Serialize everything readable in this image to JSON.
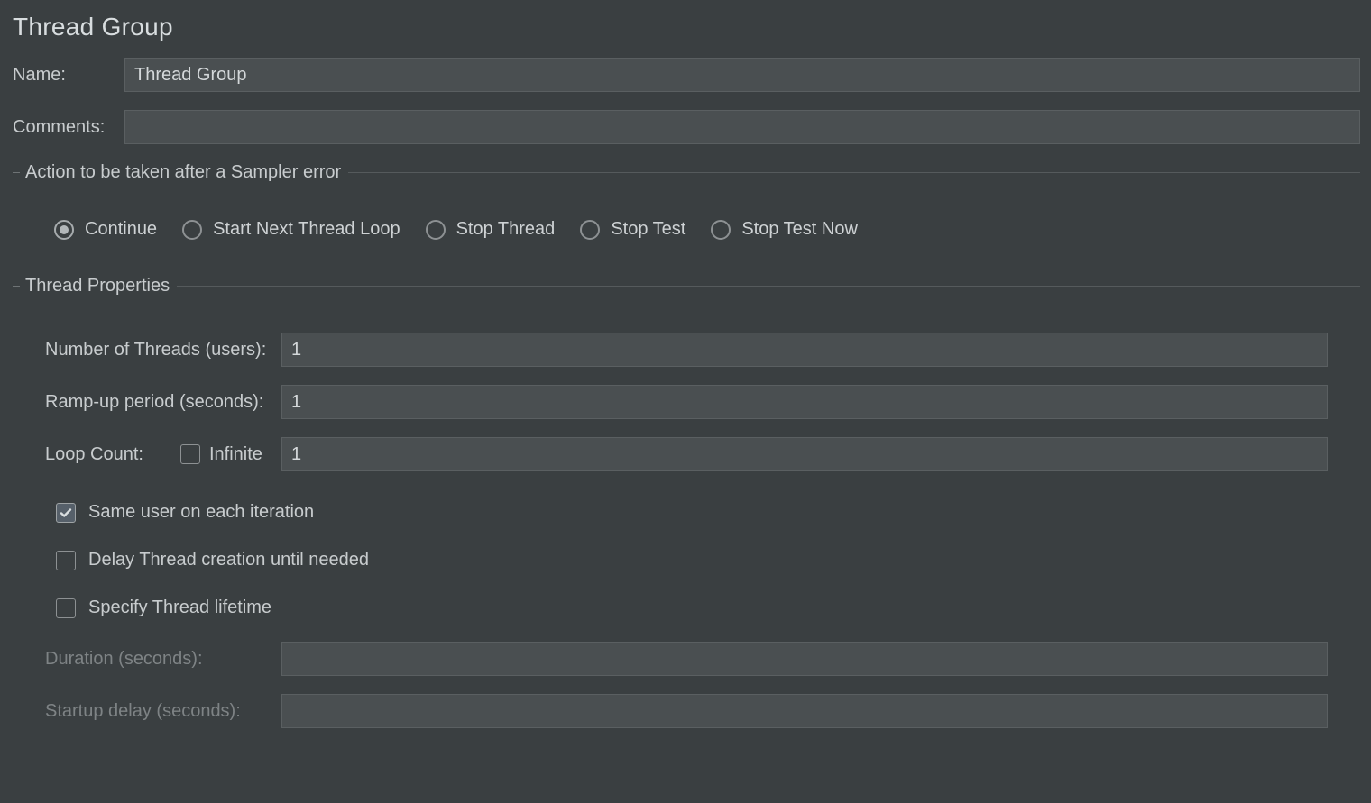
{
  "title": "Thread Group",
  "name_label": "Name:",
  "name_value": "Thread Group",
  "comments_label": "Comments:",
  "comments_value": "",
  "on_error": {
    "legend": "Action to be taken after a Sampler error",
    "options": {
      "continue": "Continue",
      "start_next_loop": "Start Next Thread Loop",
      "stop_thread": "Stop Thread",
      "stop_test": "Stop Test",
      "stop_test_now": "Stop Test Now"
    },
    "selected": "continue"
  },
  "thread_props": {
    "legend": "Thread Properties",
    "num_threads_label": "Number of Threads (users):",
    "num_threads_value": "1",
    "ramp_up_label": "Ramp-up period (seconds):",
    "ramp_up_value": "1",
    "loop_count_label": "Loop Count:",
    "loop_infinite_label": "Infinite",
    "loop_infinite_checked": false,
    "loop_count_value": "1",
    "same_user_label": "Same user on each iteration",
    "same_user_checked": true,
    "delay_create_label": "Delay Thread creation until needed",
    "delay_create_checked": false,
    "specify_lifetime_label": "Specify Thread lifetime",
    "specify_lifetime_checked": false,
    "duration_label": "Duration (seconds):",
    "duration_value": "",
    "startup_delay_label": "Startup delay (seconds):",
    "startup_delay_value": ""
  }
}
